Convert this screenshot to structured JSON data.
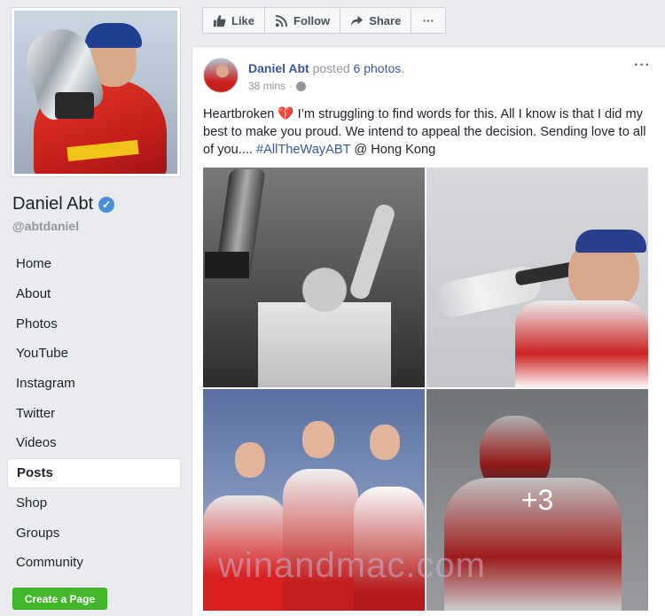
{
  "page": {
    "name": "Daniel Abt",
    "handle": "@abtdaniel",
    "verified_icon": "verified-check-icon"
  },
  "nav": {
    "items": [
      {
        "label": "Home"
      },
      {
        "label": "About"
      },
      {
        "label": "Photos"
      },
      {
        "label": "YouTube"
      },
      {
        "label": "Instagram"
      },
      {
        "label": "Twitter"
      },
      {
        "label": "Videos"
      },
      {
        "label": "Posts",
        "active": true
      },
      {
        "label": "Shop"
      },
      {
        "label": "Groups"
      },
      {
        "label": "Community"
      }
    ],
    "create_page_label": "Create a Page"
  },
  "actions": {
    "like_label": "Like",
    "follow_label": "Follow",
    "share_label": "Share",
    "more_label": "···"
  },
  "post": {
    "author": "Daniel Abt",
    "posted_text": "posted",
    "photos_link": "6 photos",
    "period": ".",
    "time": "38 mins",
    "separator": "·",
    "menu_label": "···",
    "text_before_heart": "Heartbroken ",
    "heart": "💔",
    "text_main": " I’m struggling to find words for this. All I know is that I did my best to make you proud. We intend to appeal the decision. Sending love to all of you.... ",
    "hashtag": "#AllTheWayABT",
    "text_after": " @ Hong Kong",
    "more_photos_label": "+3"
  },
  "watermark": "winandmac.com",
  "colors": {
    "link": "#365899",
    "accent_green": "#42b72a",
    "background": "#e9ebee"
  }
}
